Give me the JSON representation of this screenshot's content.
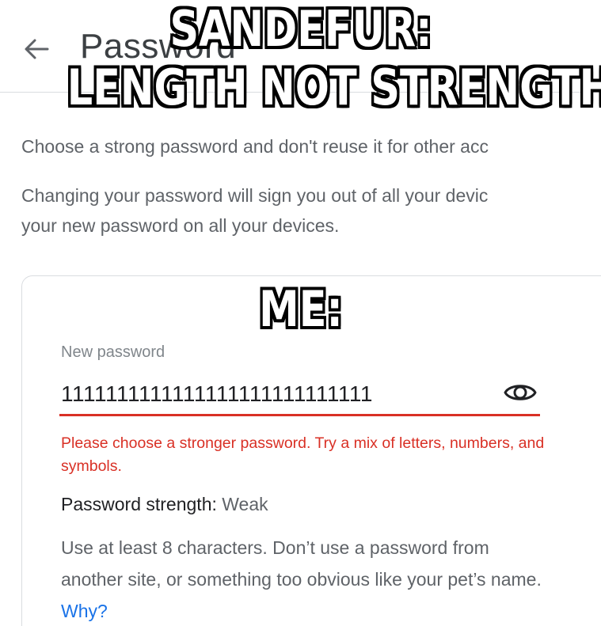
{
  "header": {
    "title": "Password",
    "back_icon": "arrow-left-icon"
  },
  "meme": {
    "top_line_1": "SANDEFUR:",
    "top_line_2": "LENGTH NOT STRENGTH",
    "middle": "ME:"
  },
  "description": {
    "line_1": "Choose a strong password and don't reuse it for other acc",
    "line_2a": "Changing your password will sign you out of all your devic",
    "line_2b": "your new password on all your devices."
  },
  "form": {
    "new_password_label": "New password",
    "new_password_value": "1111111111111111111111111111",
    "visibility_icon": "eye-icon",
    "error_message": "Please choose a stronger password. Try a mix of letters, numbers, and symbols.",
    "strength_label": "Password strength:",
    "strength_value": "Weak",
    "help_text": "Use at least 8 characters. Don’t use a password from another site, or something too obvious like your pet’s name.",
    "why_link": "Why?"
  },
  "colors": {
    "error": "#d93025",
    "link": "#1a73e8",
    "secondary_text": "#5f6368"
  }
}
